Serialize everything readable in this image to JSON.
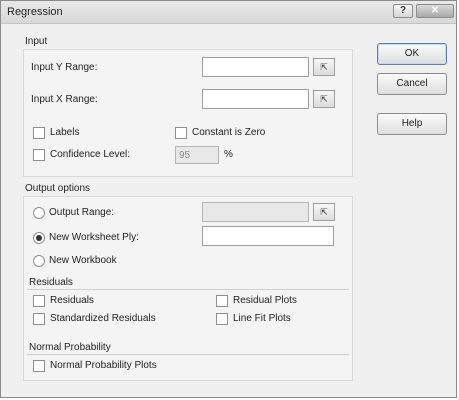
{
  "window": {
    "title": "Regression",
    "help_glyph": "?",
    "close_glyph": "✕"
  },
  "input": {
    "group_label": "Input",
    "y_range_label": "Input Y Range:",
    "y_range_value": "",
    "x_range_label": "Input X Range:",
    "x_range_value": "",
    "labels_label": "Labels",
    "constant_zero_label": "Constant is Zero",
    "confidence_label": "Confidence Level:",
    "confidence_value": "95",
    "percent": "%"
  },
  "ref_button_glyph": "⇱",
  "output": {
    "group_label": "Output options",
    "output_range_label": "Output Range:",
    "output_range_value": "",
    "new_worksheet_label": "New Worksheet Ply:",
    "new_worksheet_value": "",
    "new_workbook_label": "New Workbook",
    "selected": "new_worksheet"
  },
  "residuals": {
    "group_label": "Residuals",
    "residuals_label": "Residuals",
    "standardized_label": "Standardized Residuals",
    "residual_plots_label": "Residual Plots",
    "line_fit_label": "Line Fit Plots"
  },
  "normal_probability": {
    "group_label": "Normal Probability",
    "plots_label": "Normal Probability Plots"
  },
  "buttons": {
    "ok": "OK",
    "cancel": "Cancel",
    "help": "Help"
  }
}
